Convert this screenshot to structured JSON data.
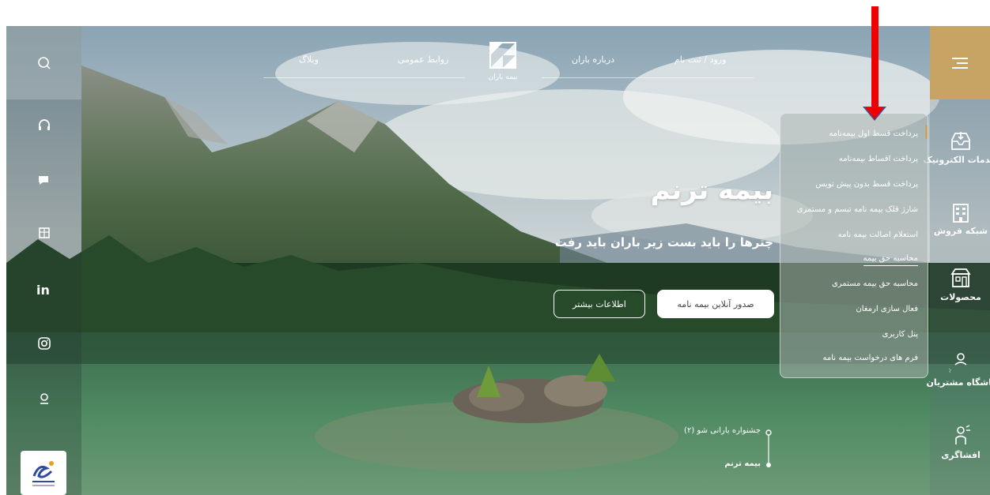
{
  "top_nav": {
    "blog": "وبلاگ",
    "public_relations": "روابط عمومی",
    "about": "درباره باران",
    "login": "ورود / ثبت نام"
  },
  "logo": {
    "text": "بیمه باران"
  },
  "hero": {
    "title": "بیمه ترنم",
    "subtitle": "چترها را باید بست زیر باران باید رفت",
    "primary_button": "صدور آنلاین بیمه نامه",
    "secondary_button": "اطلاعات بیشتر"
  },
  "dropdown_menu": {
    "items": [
      "پرداخت قسط اول بیمه‌نامه",
      "پرداخت اقساط بیمه‌نامه",
      "پرداخت قسط بدون پیش نویس",
      "شارژ قلک بیمه نامه تبسم و مستمری",
      "استعلام اصالت بیمه نامه",
      "محاسبه حق بیمه",
      "محاسبه حق بیمه مستمری",
      "فعال سازی ارمغان",
      "پنل کاربری",
      "فرم های درخواست بیمه نامه"
    ],
    "active_index": 5
  },
  "right_sidebar": {
    "items": [
      "خدمات الکترونیک",
      "شبکه فروش",
      "محصولات",
      "باشگاه مشتریان",
      "افشاگری"
    ]
  },
  "timeline": {
    "items": [
      "جشنواره بارانی شو (۲)",
      "بیمه ترنم"
    ]
  },
  "colors": {
    "menu_tile": "#c8a464",
    "annotation_arrow": "#ee0000"
  },
  "icons": {
    "left_rail": [
      "search-icon",
      "headset-icon",
      "chat-icon",
      "building-icon",
      "linkedin-icon",
      "instagram-icon",
      "location-pin-icon"
    ],
    "right_rail": [
      "hamburger-icon",
      "inbox-download-icon",
      "building-icon",
      "shop-icon",
      "club-icon",
      "whistleblower-icon"
    ]
  }
}
